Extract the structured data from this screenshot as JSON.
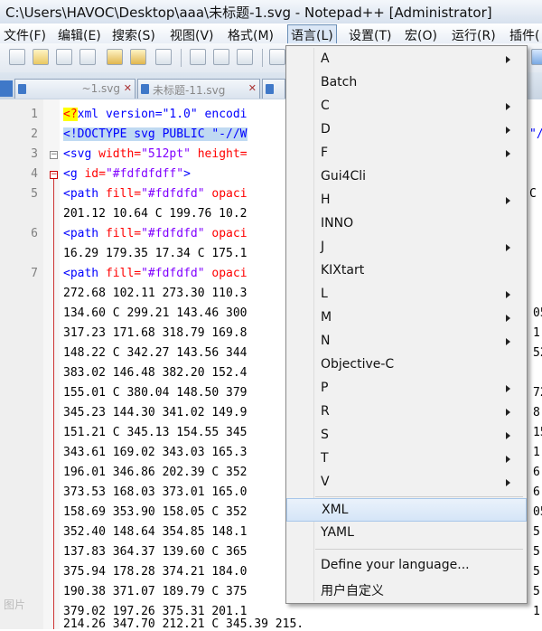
{
  "window": {
    "title": "C:\\Users\\HAVOC\\Desktop\\aaa\\未标题-1.svg - Notepad++ [Administrator]"
  },
  "menubar": [
    {
      "label": "文件(F)"
    },
    {
      "label": "编辑(E)"
    },
    {
      "label": "搜索(S)"
    },
    {
      "label": "视图(V)"
    },
    {
      "label": "格式(M)"
    },
    {
      "label": "语言(L)"
    },
    {
      "label": "设置(T)"
    },
    {
      "label": "宏(O)"
    },
    {
      "label": "运行(R)"
    },
    {
      "label": "插件("
    }
  ],
  "tabs": [
    {
      "label": "~1.svg"
    },
    {
      "label": "未标题-11.svg"
    }
  ],
  "editor": {
    "line_numbers": [
      "1",
      "2",
      "3",
      "4",
      "5",
      "6",
      "7"
    ]
  },
  "language_menu": {
    "items": [
      {
        "label": "A",
        "submenu": true
      },
      {
        "label": "Batch",
        "submenu": false
      },
      {
        "label": "C",
        "submenu": true
      },
      {
        "label": "D",
        "submenu": true
      },
      {
        "label": "F",
        "submenu": true
      },
      {
        "label": "Gui4Cli",
        "submenu": false
      },
      {
        "label": "H",
        "submenu": true
      },
      {
        "label": "INNO",
        "submenu": false
      },
      {
        "label": "J",
        "submenu": true
      },
      {
        "label": "KIXtart",
        "submenu": false
      },
      {
        "label": "L",
        "submenu": true
      },
      {
        "label": "M",
        "submenu": true
      },
      {
        "label": "N",
        "submenu": true
      },
      {
        "label": "Objective-C",
        "submenu": false
      },
      {
        "label": "P",
        "submenu": true
      },
      {
        "label": "R",
        "submenu": true
      },
      {
        "label": "S",
        "submenu": true
      },
      {
        "label": "T",
        "submenu": true
      },
      {
        "label": "V",
        "submenu": true
      },
      {
        "label": "XML",
        "submenu": false,
        "hover": true
      },
      {
        "label": "YAML",
        "submenu": false
      },
      {
        "label": "Define your language...",
        "submenu": false
      },
      {
        "label": "用户自定义",
        "submenu": false
      }
    ]
  },
  "code": {
    "l1a": "<?",
    "l1b": "xml version=\"1.0\" encodi",
    "l2": "<!DOCTYPE svg PUBLIC \"-//W",
    "l2r": "\"//W",
    "l3a": "<svg",
    "l3b": " width=",
    "l3c": "\"512pt\"",
    "l3d": " height=",
    "l4a": "<g",
    "l4b": " id=",
    "l4c": "\"#fdfdfdff\"",
    "l4d": ">",
    "l5a": "<path",
    "l5b": " fill=",
    "l5c": "\"#fdfdfd\"",
    "l5d": " opaci",
    "l5r": "C",
    "l5n": "201.12 10.64 C 199.76 10.2",
    "l6a": "<path",
    "l6b": " fill=",
    "l6c": "\"#fdfdfd\"",
    "l6d": " opaci",
    "l6n": "16.29 179.35 17.34 C 175.1",
    "l7a": "<path",
    "l7b": " fill=",
    "l7c": "\"#fdfdfd\"",
    "l7d": " opaci",
    "rows": [
      "272.68 102.11 273.30 110.3",
      "134.60 C 299.21 143.46 300",
      "317.23 171.68 318.79 169.8",
      "148.22 C 342.27 143.56 344",
      "383.02 146.48 382.20 152.4",
      "155.01 C 380.04 148.50 379",
      "345.23 144.30 341.02 149.9",
      "151.21 C 345.13 154.55 345",
      "343.61 169.02 343.03 165.3",
      "196.01 346.86 202.39 C 352",
      "373.53 168.03 373.01 165.0",
      "158.69 353.90 158.05 C 352",
      "352.40 148.64 354.85 148.1",
      "137.83 364.37 139.60 C 365",
      "375.94 178.28 374.21 184.0",
      "190.38 371.07 189.79 C 375",
      "379.02 197.26 375.31 201.1",
      "214.26 347.70 212.21 C 345.39 215."
    ],
    "right_col": [
      "05",
      "1",
      "52",
      "72",
      "8",
      "15",
      "1",
      "6",
      "6",
      "05",
      "5",
      "5",
      "5",
      "5",
      "1"
    ]
  },
  "watermark": "图片"
}
